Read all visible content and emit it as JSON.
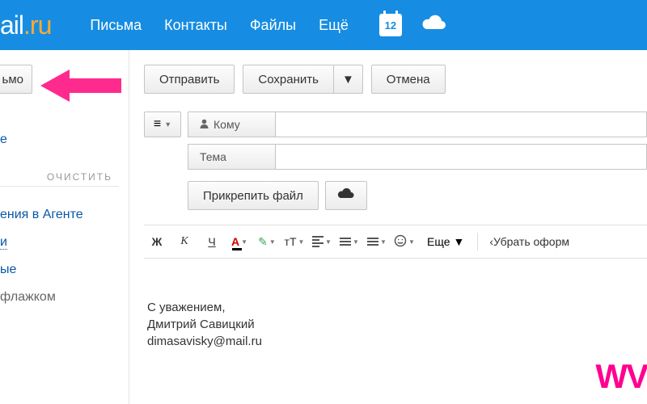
{
  "header": {
    "logo_prefix": "ail",
    "logo_dot": ".",
    "logo_suffix": "ru",
    "nav": [
      "Письма",
      "Контакты",
      "Файлы",
      "Ещё"
    ],
    "calendar_day": "12"
  },
  "sidebar": {
    "compose_tail": "ьмо",
    "links": [
      "е",
      "ения в Агенте",
      "и",
      "ые",
      "флажком"
    ],
    "clear": "ОЧИСТИТЬ"
  },
  "toolbar": {
    "send": "Отправить",
    "save": "Сохранить",
    "cancel": "Отмена"
  },
  "fields": {
    "to_label": "Кому",
    "subject_label": "Тема",
    "to_value": "",
    "subject_value": ""
  },
  "attach": {
    "label": "Прикрепить файл"
  },
  "editor": {
    "bold": "Ж",
    "italic": "К",
    "underline": "Ч",
    "color": "А",
    "size": "тТ",
    "more": "Еще",
    "remove_format": "Убрать оформ"
  },
  "signature": {
    "line1": "С уважением,",
    "line2": "Дмитрий Савицкий",
    "line3": "dimasavisky@mail.ru"
  },
  "watermark": "WV"
}
